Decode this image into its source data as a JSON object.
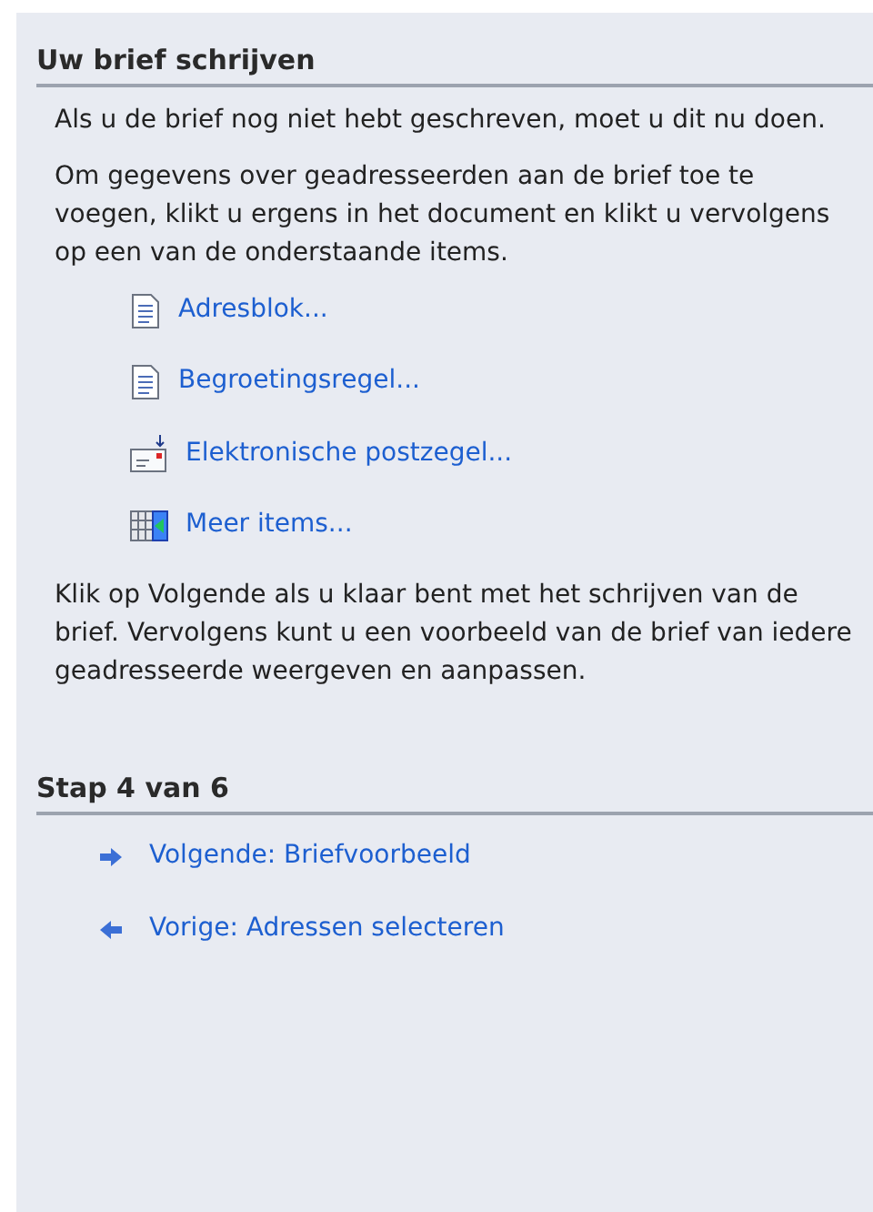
{
  "section": {
    "title": "Uw brief schrijven"
  },
  "paragraphs_top": [
    "Als u de brief nog niet hebt geschreven, moet u dit nu doen.",
    "Om gegevens over geadresseerden aan de brief toe te voegen, klikt u ergens in het document en klikt u vervolgens op een van de onderstaande items."
  ],
  "items": [
    {
      "kind": "document",
      "label": "Adresblok..."
    },
    {
      "kind": "document",
      "label": "Begroetingsregel..."
    },
    {
      "kind": "stamp",
      "label": "Elektronische postzegel..."
    },
    {
      "kind": "more",
      "label": "Meer items..."
    }
  ],
  "paragraph_bottom": "Klik op Volgende als u klaar bent met het schrijven van de brief. Vervolgens kunt u een voorbeeld van de brief van iedere geadresseerde weergeven en aanpassen.",
  "step": {
    "title": "Stap 4 van 6"
  },
  "navigation": [
    {
      "kind": "next",
      "label": "Volgende: Briefvoorbeeld"
    },
    {
      "kind": "previous",
      "label": "Vorige: Adressen selecteren"
    }
  ]
}
